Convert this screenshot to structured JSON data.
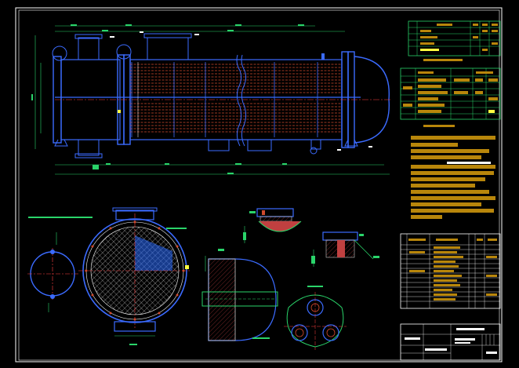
{
  "colors": {
    "background": "#000000",
    "frame": "#ffffff",
    "shell": "#3b6bff",
    "tubes": "#d04a2e",
    "dimension": "#2ad46a",
    "text_fill": "#b8860b",
    "highlight": "#ffff40",
    "hatch": "#c8c8c8"
  },
  "icons": [
    "heat-exchanger-elevation",
    "tube-sheet-section",
    "nozzle-detail",
    "saddle-support"
  ],
  "tables": {
    "nozzle_rows": 4,
    "design_data_rows": 8,
    "parts_rows": 14
  }
}
